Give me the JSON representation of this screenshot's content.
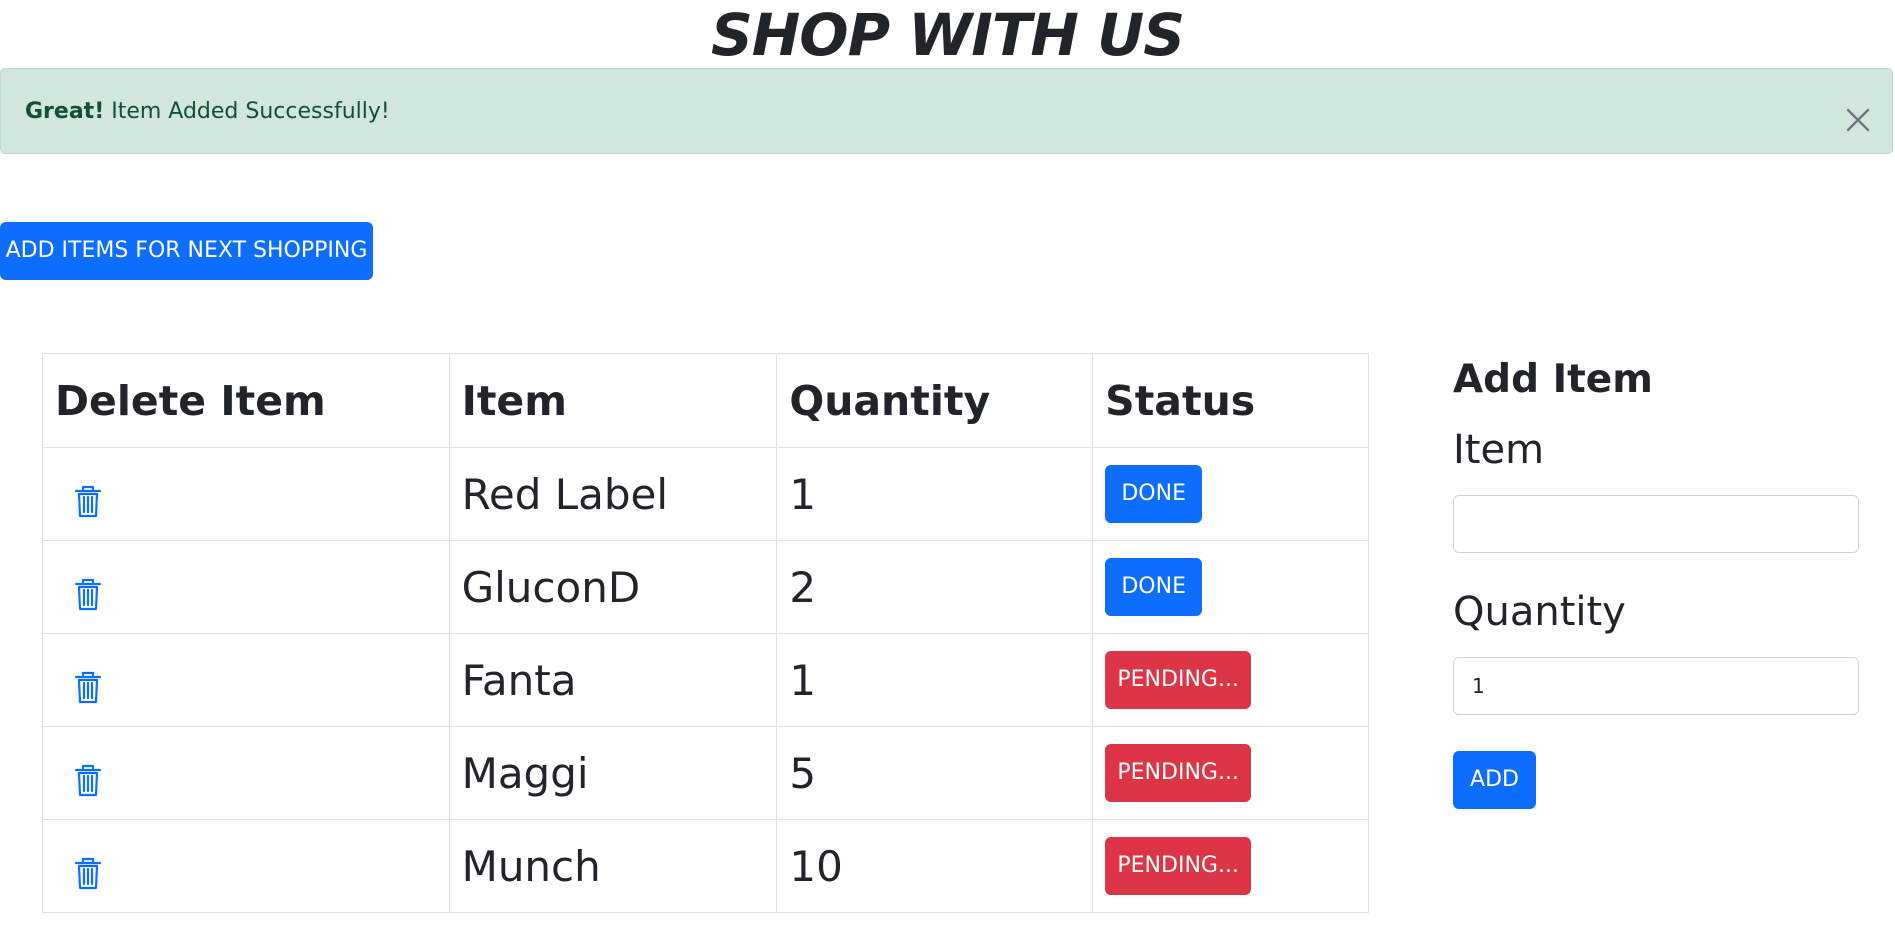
{
  "page": {
    "title": "SHOP WITH US"
  },
  "alert": {
    "strong": "Great!",
    "message": "Item Added Successfully!",
    "close_icon": "close-icon",
    "background": "#d1e7dd",
    "text_color": "#0f5132"
  },
  "toolbar": {
    "next_shopping_label": "ADD ITEMS FOR NEXT SHOPPING"
  },
  "table": {
    "headers": {
      "delete": "Delete Item",
      "item": "Item",
      "quantity": "Quantity",
      "status": "Status"
    },
    "delete_icon": "trash-icon",
    "rows": [
      {
        "item": "Red Label",
        "quantity": "1",
        "status": "DONE"
      },
      {
        "item": "GluconD",
        "quantity": "2",
        "status": "DONE"
      },
      {
        "item": "Fanta",
        "quantity": "1",
        "status": "PENDING..."
      },
      {
        "item": "Maggi",
        "quantity": "5",
        "status": "PENDING..."
      },
      {
        "item": "Munch",
        "quantity": "10",
        "status": "PENDING..."
      }
    ]
  },
  "add_form": {
    "heading": "Add Item",
    "item_label": "Item",
    "item_value": "",
    "quantity_label": "Quantity",
    "quantity_value": "1",
    "add_label": "ADD"
  },
  "colors": {
    "primary": "#0d6efd",
    "danger": "#dc3545"
  }
}
